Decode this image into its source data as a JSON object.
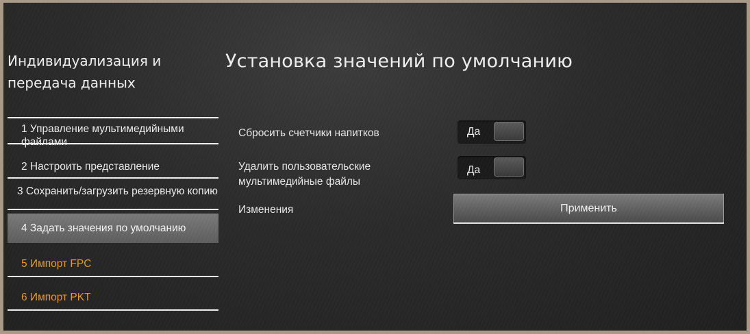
{
  "sidebar": {
    "title": "Индивидуализация и передача данных",
    "items": [
      {
        "label": "1 Управление мультимедийными файлами"
      },
      {
        "label": "2 Настроить представление"
      },
      {
        "label": "3 Сохранить/загрузить резервную копию"
      },
      {
        "label": "4 Задать значения по умолчанию",
        "active": true
      },
      {
        "label": "5 Импорт FPC"
      },
      {
        "label": "6 Импорт PKT"
      }
    ]
  },
  "main": {
    "title": "Установка значений по умолчанию",
    "settings": [
      {
        "label": "Сбросить счетчики напитков",
        "toggle_value": "Да"
      },
      {
        "label": "Удалить пользовательские мультимедийные файлы",
        "toggle_value": "Да"
      }
    ],
    "changes": {
      "label": "Изменения",
      "button_label": "Применить"
    }
  },
  "colors": {
    "background": "#2b2b2b",
    "frame": "#a89a86",
    "text": "#f2f2f2",
    "accent_orange": "#e59a2a",
    "active_item": "#6b6b6b"
  }
}
